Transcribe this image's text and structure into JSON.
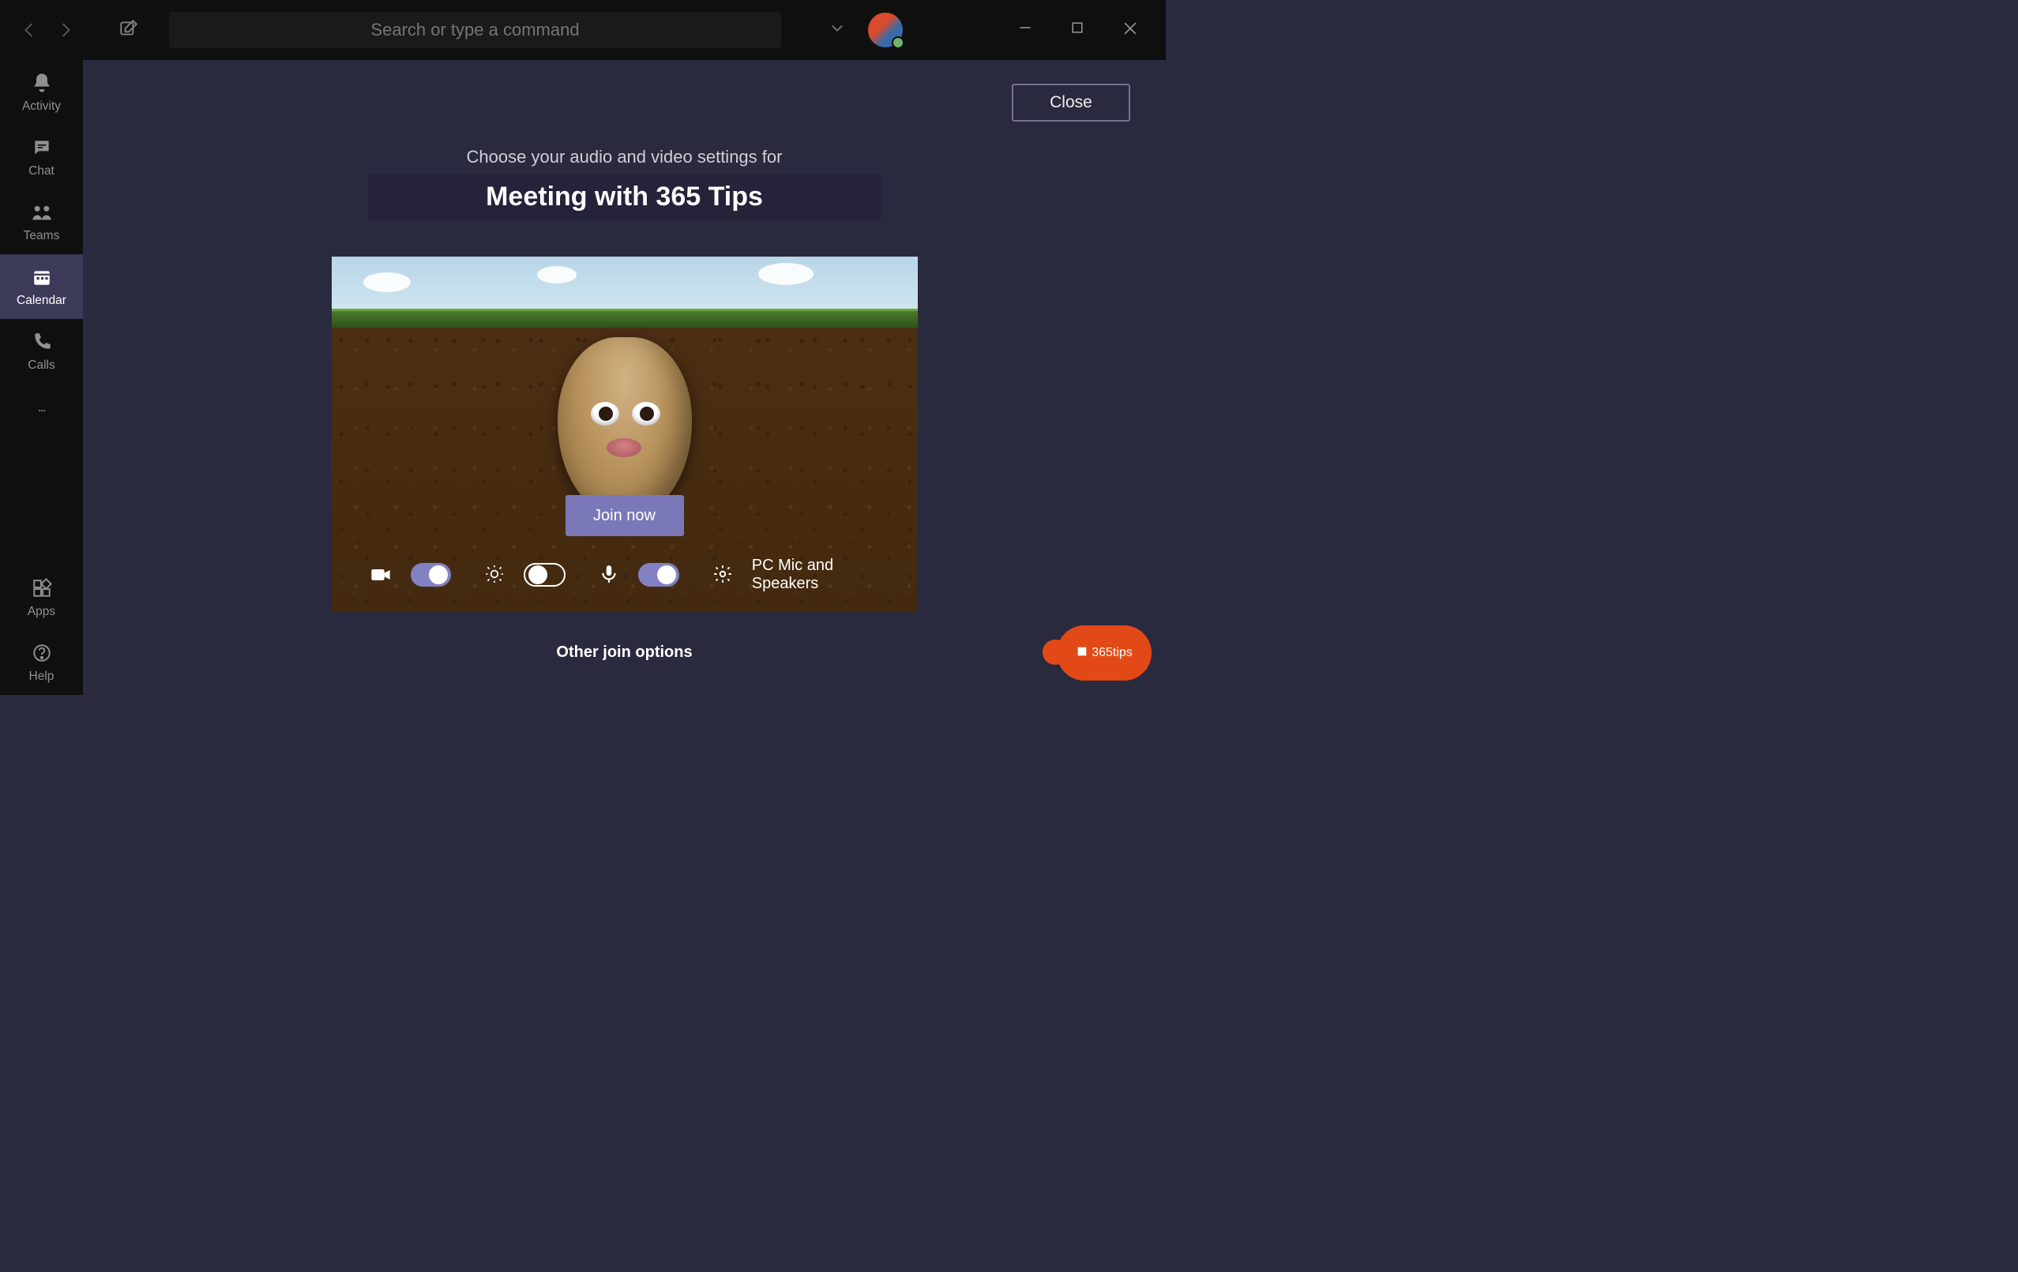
{
  "titlebar": {
    "search_placeholder": "Search or type a command"
  },
  "sidebar": {
    "items": [
      {
        "label": "Activity"
      },
      {
        "label": "Chat"
      },
      {
        "label": "Teams"
      },
      {
        "label": "Calendar"
      },
      {
        "label": "Calls"
      }
    ],
    "apps_label": "Apps",
    "help_label": "Help"
  },
  "main": {
    "close_label": "Close",
    "pre_heading": "Choose your audio and video settings for",
    "meeting_title": "Meeting with 365 Tips",
    "join_label": "Join now",
    "device_label": "PC Mic and Speakers",
    "other_options": "Other join options"
  },
  "brand": {
    "label": "365tips"
  }
}
